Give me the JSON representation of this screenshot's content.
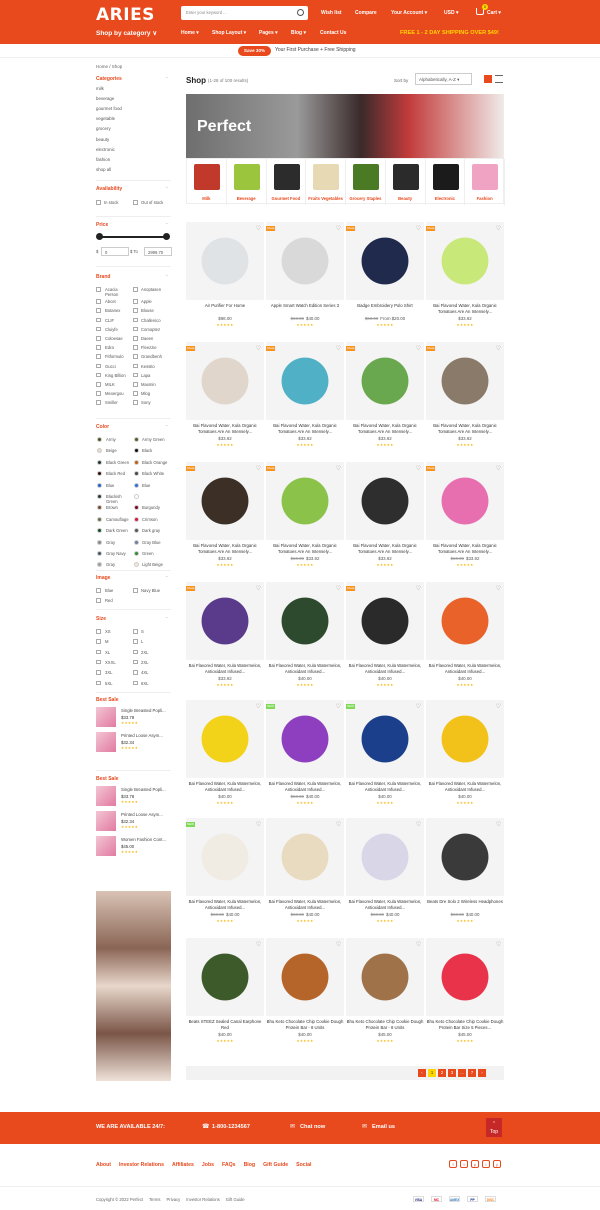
{
  "header": {
    "logo": "ARIES",
    "search_placeholder": "Enter your keyword ...",
    "links": [
      "Wish list",
      "Compare",
      "Your Account ▾",
      "USD ▾"
    ],
    "cart_label": "Cart ▾",
    "cart_count": "0",
    "shop_by_category": "Shop by category ∨",
    "nav": [
      "Home ▾",
      "Shop Layout ▾",
      "Pages ▾",
      "Blog ▾",
      "Contact Us"
    ],
    "shipping_note": "FREE 1 - 2 DAY SHIPPING OVER $49!"
  },
  "promo": {
    "badge": "Save 30%",
    "text": "Your First Purchase + Free Shipping"
  },
  "breadcrumb": "Home  /  Shop",
  "sidebar": {
    "categories_title": "Categories",
    "categories": [
      "milk",
      "beverage",
      "gourmet food",
      "vegetable",
      "grocery",
      "beauty",
      "electronic",
      "fashion",
      "shop all"
    ],
    "availability_title": "Availability",
    "availability": [
      "In stock",
      "Out of stock"
    ],
    "price_title": "Price",
    "price_currency": "$",
    "price_min": "0",
    "price_to": "To",
    "price_max": "2999.70",
    "brand_title": "Brand",
    "brands_left": [
      "Acacia Person",
      "Abcet",
      "Botanex",
      "CLIF",
      "Cluiyfe",
      "Coloesae",
      "Edra",
      "Fitformulo",
      "Gucci",
      "King Billion",
      "MILK",
      "Mexergou",
      "Smiller"
    ],
    "brands_right": [
      "Anoptasen",
      "Apple",
      "Blouse",
      "Challenico",
      "Comoptez",
      "Daeen",
      "Fleezzie",
      "Grandbenh",
      "Kessito",
      "Lapa",
      "Maxmin",
      "Mlog",
      "Sony"
    ],
    "color_title": "Color",
    "colors_left": [
      {
        "name": "Army",
        "hex": "#4b5320"
      },
      {
        "name": "Beige",
        "hex": "#e8dcc2"
      },
      {
        "name": "Black Green",
        "hex": "#1f3a2b"
      },
      {
        "name": "Black Red",
        "hex": "#3b0c0c"
      },
      {
        "name": "Blue",
        "hex": "#1e63c9"
      },
      {
        "name": "Blackish Green",
        "hex": "#2a3a30"
      },
      {
        "name": "Brown",
        "hex": "#7a4a26"
      },
      {
        "name": "Camouflage",
        "hex": "#6b7047"
      },
      {
        "name": "Dark Green",
        "hex": "#124d25"
      },
      {
        "name": "Gray",
        "hex": "#8a8a8a"
      },
      {
        "name": "Gray Navy",
        "hex": "#4a5568"
      },
      {
        "name": "Gray",
        "hex": "#9e9e9e"
      }
    ],
    "colors_right": [
      {
        "name": "Army Green",
        "hex": "#545b2b"
      },
      {
        "name": "Black",
        "hex": "#111111"
      },
      {
        "name": "Black Orange",
        "hex": "#c45a10"
      },
      {
        "name": "Black White",
        "hex": "#444444"
      },
      {
        "name": "Blue",
        "hex": "#2a6fdb"
      },
      {
        "name": "",
        "hex": "#ffffff"
      },
      {
        "name": "Burgundy",
        "hex": "#800020"
      },
      {
        "name": "Crimson",
        "hex": "#dc143c"
      },
      {
        "name": "Dark gray",
        "hex": "#555555"
      },
      {
        "name": "Gray Blue",
        "hex": "#6b7fa3"
      },
      {
        "name": "Green",
        "hex": "#2e8b2e"
      },
      {
        "name": "Light Beige",
        "hex": "#f2e8d5"
      }
    ],
    "image_title": "Image",
    "images_left": [
      "Blue",
      "Red"
    ],
    "images_right": [
      "Navy Blue"
    ],
    "size_title": "Size",
    "sizes_left": [
      "XS",
      "M",
      "XL",
      "XXXL",
      "3XL",
      "5XL"
    ],
    "sizes_right": [
      "S",
      "L",
      "2XL",
      "2XL",
      "4XL",
      "6XL"
    ],
    "bestsale1_title": "Best Sale",
    "bestsale1": [
      {
        "name": "Single Breasted Popli...",
        "price": "$33.78"
      },
      {
        "name": "Printed Loose Asym...",
        "price": "$32.34"
      }
    ],
    "bestsale2_title": "Best Sale",
    "bestsale2": [
      {
        "name": "Single Breasted Popli...",
        "price": "$33.78"
      },
      {
        "name": "Printed Loose Asym...",
        "price": "$32.34"
      },
      {
        "name": "Women Fashion Cont...",
        "price": "$45.00"
      }
    ],
    "stars": "★★★★★"
  },
  "shop": {
    "title": "Shop",
    "results": "(1-28 of 100 results)",
    "sort_label": "Sort by",
    "sort_value": "Alphabetically, A-Z ▾"
  },
  "banner": {
    "text": "Perfect"
  },
  "category_tiles": [
    {
      "label": "Milk",
      "color": "#c0392b"
    },
    {
      "label": "Beverage",
      "color": "#9bc53d"
    },
    {
      "label": "Gourmet Food",
      "color": "#2c2c2c"
    },
    {
      "label": "Fruits Vegetables",
      "color": "#e8d9b5"
    },
    {
      "label": "Grocery Staples",
      "color": "#4a7a23"
    },
    {
      "label": "Beauty",
      "color": "#2b2b2b"
    },
    {
      "label": "Electronic",
      "color": "#1b1b1b"
    },
    {
      "label": "Fashion",
      "color": "#f0a3c2"
    }
  ],
  "products": [
    {
      "name": "Air Purifier For Home",
      "old": "",
      "price": "$98.00",
      "badge": "",
      "color": "#dfe3e6"
    },
    {
      "name": "Apple Smart Watch Edition Series 3",
      "old": "$60.00",
      "price": "$40.00",
      "badge": "SALE",
      "color": "#d9d9d9"
    },
    {
      "name": "Badge Embroidery Polo Shirt",
      "old": "$60.00",
      "price": "From $20.00",
      "badge": "SALE",
      "color": "#1f2a4d"
    },
    {
      "name": "Bai Flavored Water, Kula Organic Tomatoes Are An Intensely...",
      "old": "",
      "price": "$33.92",
      "badge": "SALE",
      "color": "#c9e87a"
    },
    {
      "name": "Bai Flavored Water, Kula Organic Tomatoes Are An Intensely...",
      "old": "",
      "price": "$33.92",
      "badge": "SALE",
      "color": "#e0d6cc"
    },
    {
      "name": "Bai Flavored Water, Kula Organic Tomatoes Are An Intensely...",
      "old": "",
      "price": "$33.92",
      "badge": "SALE",
      "color": "#4fb0c6"
    },
    {
      "name": "Bai Flavored Water, Kula Organic Tomatoes Are An Intensely...",
      "old": "",
      "price": "$33.92",
      "badge": "SALE",
      "color": "#6aa84f"
    },
    {
      "name": "Bai Flavored Water, Kula Organic Tomatoes Are An Intensely...",
      "old": "",
      "price": "$33.92",
      "badge": "SALE",
      "color": "#8a7a6a"
    },
    {
      "name": "Bai Flavored Water, Kula Organic Tomatoes Are An Intensely...",
      "old": "",
      "price": "$33.92",
      "badge": "SALE",
      "color": "#3b2f26"
    },
    {
      "name": "Bai Flavored Water, Kula Organic Tomatoes Are An Intensely...",
      "old": "$60.00",
      "price": "$33.92",
      "badge": "SALE",
      "color": "#8bc34a"
    },
    {
      "name": "Bai Flavored Water, Kula Organic Tomatoes Are An Intensely...",
      "old": "",
      "price": "$33.92",
      "badge": "",
      "color": "#2e2e2e"
    },
    {
      "name": "Bai Flavored Water, Kula Organic Tomatoes Are An Intensely...",
      "old": "$60.00",
      "price": "$33.92",
      "badge": "SALE",
      "color": "#e76fb0"
    },
    {
      "name": "Bai Flavored Water, Kula Watermelon, Antioxidant Infused...",
      "old": "",
      "price": "$33.92",
      "badge": "SALE",
      "color": "#5a3a8a"
    },
    {
      "name": "Bai Flavored Water, Kula Watermelon, Antioxidant Infused...",
      "old": "",
      "price": "$40.00",
      "badge": "",
      "color": "#2e4a2e"
    },
    {
      "name": "Bai Flavored Water, Kula Watermelon, Antioxidant Infused...",
      "old": "",
      "price": "$40.00",
      "badge": "SALE",
      "color": "#2a2a2a"
    },
    {
      "name": "Bai Flavored Water, Kula Watermelon, Antioxidant Infused...",
      "old": "",
      "price": "$40.00",
      "badge": "",
      "color": "#e8622a"
    },
    {
      "name": "Bai Flavored Water, Kula Watermelon, Antioxidant Infused...",
      "old": "",
      "price": "$40.00",
      "badge": "",
      "color": "#f3d21a"
    },
    {
      "name": "Bai Flavored Water, Kula Watermelon, Antioxidant Infused...",
      "old": "$60.00",
      "price": "$40.00",
      "badge": "NEW",
      "color": "#8e3fbf"
    },
    {
      "name": "Bai Flavored Water, Kula Watermelon, Antioxidant Infused...",
      "old": "",
      "price": "$40.00",
      "badge": "NEW",
      "color": "#1c3f8c"
    },
    {
      "name": "Bai Flavored Water, Kula Watermelon, Antioxidant Infused...",
      "old": "",
      "price": "$40.00",
      "badge": "",
      "color": "#f2c21a"
    },
    {
      "name": "Bai Flavored Water, Kula Watermelon, Antioxidant Infused...",
      "old": "$60.00",
      "price": "$40.00",
      "badge": "NEW",
      "color": "#f0ece4"
    },
    {
      "name": "Bai Flavored Water, Kula Watermelon, Antioxidant Infused...",
      "old": "$60.00",
      "price": "$40.00",
      "badge": "",
      "color": "#e9dbc0"
    },
    {
      "name": "Bai Flavored Water, Kula Watermelon, Antioxidant Infused...",
      "old": "$60.00",
      "price": "$40.00",
      "badge": "",
      "color": "#d9d6e8"
    },
    {
      "name": "Beats Dre Solo 2 Wireless Headphones",
      "old": "$60.00",
      "price": "$40.00",
      "badge": "",
      "color": "#3a3a3a"
    },
    {
      "name": "Beats STEEZ Sealed Canal Earphone Red",
      "old": "",
      "price": "$40.00",
      "badge": "",
      "color": "#3d5a2a"
    },
    {
      "name": "Bhu Keto Chocolate Chip Cookie Dough Protein Bar - 8 Units",
      "old": "",
      "price": "$40.00",
      "badge": "",
      "color": "#b5652a"
    },
    {
      "name": "Bhu Keto Chocolate Chip Cookie Dough Protein Bar - 8 Units",
      "old": "",
      "price": "$45.00",
      "badge": "",
      "color": "#a0724a"
    },
    {
      "name": "Bhu Keto Chocolate Chip Cookie Dough Protein Bar Size 5 Pieces...",
      "old": "",
      "price": "$45.00",
      "badge": "",
      "color": "#e8334a"
    }
  ],
  "pagination": [
    "‹",
    "1",
    "2",
    "3",
    "...",
    "7",
    "›"
  ],
  "footer": {
    "available": "WE ARE AVAILABLE 24/7:",
    "phone": "1-800-1234567",
    "chat": "Chat now",
    "email": "Email us",
    "top": "Top",
    "links": [
      "About",
      "Investor Relations",
      "Affiliates",
      "Jobs",
      "FAQs",
      "Blog",
      "Gift Guide",
      "Social"
    ],
    "social": [
      "f",
      "t",
      "p",
      "i",
      "y"
    ],
    "copyright": "Copyright © 2022 Perfect",
    "bottom_links": [
      "Terms",
      "Privacy",
      "Investor Relations",
      "Gift Guide"
    ],
    "payments": [
      {
        "name": "VISA",
        "color": "#1a1f71"
      },
      {
        "name": "MC",
        "color": "#eb001b"
      },
      {
        "name": "AMEX",
        "color": "#2e77bb"
      },
      {
        "name": "PP",
        "color": "#003087"
      },
      {
        "name": "DISC",
        "color": "#f58220"
      }
    ]
  }
}
